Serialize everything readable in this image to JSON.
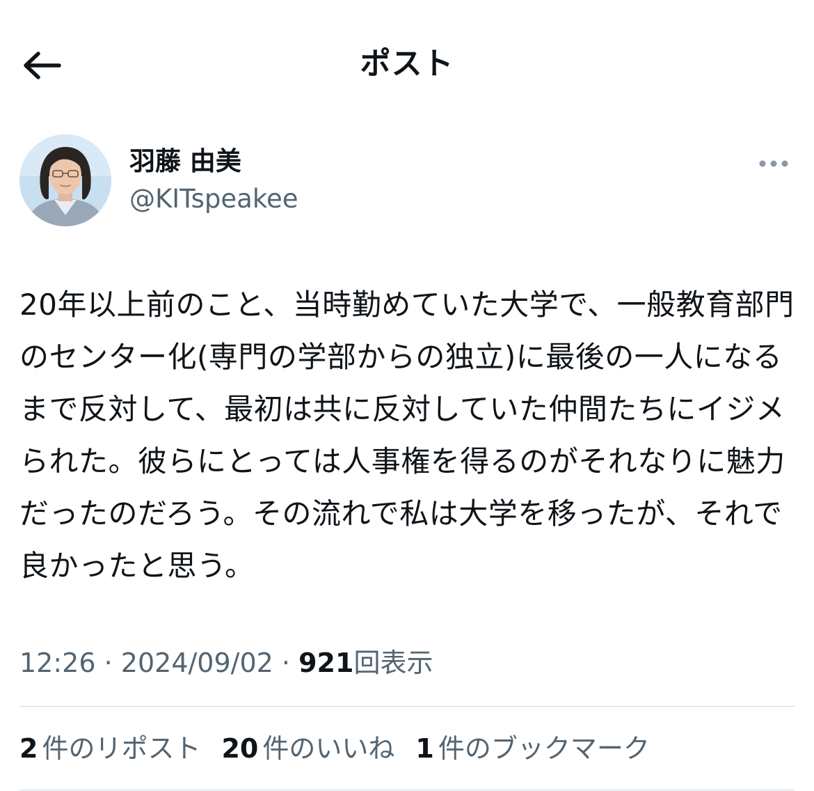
{
  "header": {
    "title": "ポスト",
    "back_icon": "arrow-left-icon"
  },
  "author": {
    "display_name": "羽藤 由美",
    "handle": "@KITspeakee",
    "more_icon": "more-horizontal-icon"
  },
  "post": {
    "text": "20年以上前のこと、当時勤めていた大学で、一般教育部門のセンター化(専門の学部からの独立)に最後の一人になるまで反対して、最初は共に反対していた仲間たちにイジメられた。彼らにとっては人事権を得るのがそれなりに魅力だったのだろう。その流れで私は大学を移ったが、それで良かったと思う。"
  },
  "meta": {
    "time": "12:26",
    "separator": "·",
    "date": "2024/09/02",
    "views_count": "921",
    "views_label": "回表示"
  },
  "stats": {
    "reposts_count": "2",
    "reposts_label": "件のリポスト",
    "likes_count": "20",
    "likes_label": "件のいいね",
    "bookmarks_count": "1",
    "bookmarks_label": "件のブックマーク"
  },
  "colors": {
    "text_primary": "#0f1419",
    "text_secondary": "#536471",
    "divider": "#cfd9de"
  }
}
